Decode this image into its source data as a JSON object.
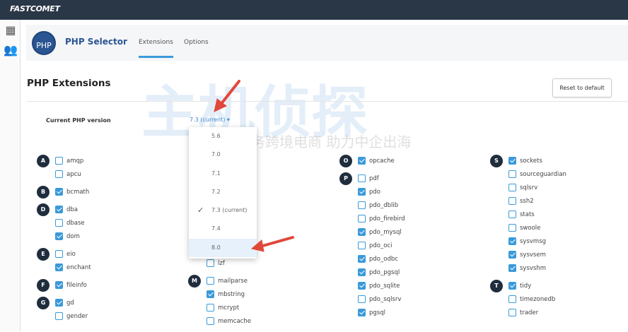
{
  "brand": "FASTCOMET",
  "sidebar": {
    "icons": [
      "grid-icon",
      "users-icon"
    ]
  },
  "app": {
    "logo_text": "PHP",
    "title": "PHP Selector",
    "tabs": [
      {
        "label": "Extensions",
        "active": true
      },
      {
        "label": "Options",
        "active": false
      }
    ]
  },
  "page": {
    "title": "PHP Extensions",
    "reset_label": "Reset to default",
    "version_label": "Current PHP version",
    "version_value": "7.3 (current) ▾"
  },
  "dropdown": {
    "options": [
      {
        "label": "5.6"
      },
      {
        "label": "7.0"
      },
      {
        "label": "7.1"
      },
      {
        "label": "7.2"
      },
      {
        "label": "7.3 (current)",
        "selected": true
      },
      {
        "label": "7.4"
      },
      {
        "label": "8.0",
        "highlighted": true
      }
    ]
  },
  "columns": [
    [
      {
        "letter": "A",
        "items": [
          [
            "amqp",
            false
          ],
          [
            "apcu",
            false
          ]
        ]
      },
      {
        "letter": "B",
        "items": [
          [
            "bcmath",
            true
          ]
        ]
      },
      {
        "letter": "D",
        "items": [
          [
            "dba",
            true
          ],
          [
            "dbase",
            false
          ],
          [
            "dom",
            true
          ]
        ]
      },
      {
        "letter": "E",
        "items": [
          [
            "eio",
            false
          ],
          [
            "enchant",
            true
          ]
        ]
      },
      {
        "letter": "F",
        "items": [
          [
            "fileinfo",
            true
          ]
        ]
      },
      {
        "letter": "G",
        "items": [
          [
            "gd",
            true
          ],
          [
            "gender",
            false
          ]
        ]
      }
    ],
    [
      {
        "letter": "",
        "items": [
          [
            "lzf",
            false
          ]
        ]
      },
      {
        "letter": "M",
        "items": [
          [
            "mailparse",
            false
          ],
          [
            "mbstring",
            true
          ],
          [
            "mcrypt",
            false
          ],
          [
            "memcache",
            false
          ]
        ]
      }
    ],
    [
      {
        "letter": "O",
        "items": [
          [
            "opcache",
            true
          ]
        ]
      },
      {
        "letter": "P",
        "items": [
          [
            "pdf",
            false
          ],
          [
            "pdo",
            true
          ],
          [
            "pdo_dblib",
            false
          ],
          [
            "pdo_firebird",
            false
          ],
          [
            "pdo_mysql",
            true
          ],
          [
            "pdo_oci",
            false
          ],
          [
            "pdo_odbc",
            true
          ],
          [
            "pdo_pgsql",
            true
          ],
          [
            "pdo_sqlite",
            true
          ],
          [
            "pdo_sqlsrv",
            false
          ],
          [
            "pgsql",
            true
          ]
        ]
      }
    ],
    [
      {
        "letter": "S",
        "items": [
          [
            "sockets",
            true
          ],
          [
            "sourceguardian",
            false
          ],
          [
            "sqlsrv",
            false
          ],
          [
            "ssh2",
            false
          ],
          [
            "stats",
            false
          ],
          [
            "swoole",
            false
          ],
          [
            "sysvmsg",
            true
          ],
          [
            "sysvsem",
            true
          ],
          [
            "sysvshm",
            true
          ]
        ]
      },
      {
        "letter": "T",
        "items": [
          [
            "tidy",
            true
          ],
          [
            "timezonedb",
            false
          ],
          [
            "trader",
            false
          ]
        ]
      }
    ]
  ],
  "watermark": {
    "line1": "主机侦探",
    "line2": "服务跨境电商 助力中企出海"
  }
}
